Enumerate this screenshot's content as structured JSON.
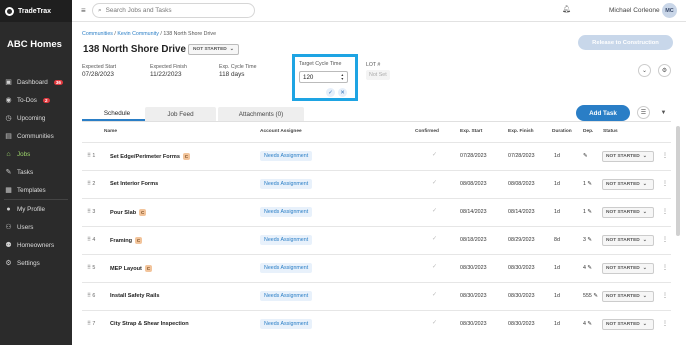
{
  "sidebar": {
    "brand": "TradeTrax",
    "company": "ABC Homes",
    "items": [
      {
        "label": "Dashboard",
        "icon": "dashboard-icon",
        "badge": "36"
      },
      {
        "label": "To-Dos",
        "icon": "todo-icon",
        "badge": "2"
      },
      {
        "label": "Upcoming",
        "icon": "calendar-icon",
        "badge": ""
      },
      {
        "label": "Communities",
        "icon": "communities-icon",
        "badge": ""
      },
      {
        "label": "Jobs",
        "icon": "home-icon",
        "badge": ""
      },
      {
        "label": "Tasks",
        "icon": "wrench-icon",
        "badge": ""
      },
      {
        "label": "Templates",
        "icon": "templates-icon",
        "badge": ""
      },
      {
        "label": "My Profile",
        "icon": "profile-icon",
        "badge": ""
      },
      {
        "label": "Users",
        "icon": "users-icon",
        "badge": ""
      },
      {
        "label": "Homeowners",
        "icon": "homeowners-icon",
        "badge": ""
      },
      {
        "label": "Settings",
        "icon": "gear-icon",
        "badge": ""
      }
    ],
    "active": "Jobs"
  },
  "topbar": {
    "search_placeholder": "Search Jobs and Tasks",
    "user_name": "Michael Corleone",
    "avatar_initials": "MC"
  },
  "job": {
    "breadcrumb": {
      "communities": "Communities",
      "community": "Kevin Community",
      "current": "138 North Shore Drive"
    },
    "title": "138 North Shore Drive",
    "status": "NOT STARTED",
    "release_button": "Release to Construction",
    "expected_start_label": "Expected Start",
    "expected_start": "07/28/2023",
    "expected_finish_label": "Expected Finish",
    "expected_finish": "11/22/2023",
    "cycle_time_label": "Exp. Cycle Time",
    "cycle_time": "118 days",
    "target_cycle_label": "Target Cycle Time",
    "target_cycle_value": "120",
    "lot_label": "LOT #",
    "lot_placeholder": "Not Set"
  },
  "tabs": [
    {
      "label": "Schedule"
    },
    {
      "label": "Job Feed"
    },
    {
      "label": "Attachments (0)"
    }
  ],
  "add_task_label": "Add Task",
  "table": {
    "headers": {
      "name": "Name",
      "assignee": "Account Assignee",
      "confirmed": "Confirmed",
      "start": "Exp. Start",
      "finish": "Exp. Finish",
      "duration": "Duration",
      "dep": "Dep.",
      "status": "Status"
    },
    "rows": [
      {
        "num": "1",
        "name": "Set Edge/Perimeter Forms",
        "badge": "C",
        "assignee": "Needs Assignment",
        "start": "07/28/2023",
        "finish": "07/28/2023",
        "duration": "1d",
        "dep": "",
        "status": "NOT STARTED"
      },
      {
        "num": "2",
        "name": "Set Interior Forms",
        "badge": "",
        "assignee": "Needs Assignment",
        "start": "08/08/2023",
        "finish": "08/08/2023",
        "duration": "1d",
        "dep": "1",
        "status": "NOT STARTED"
      },
      {
        "num": "3",
        "name": "Pour Slab",
        "badge": "C",
        "assignee": "Needs Assignment",
        "start": "08/14/2023",
        "finish": "08/14/2023",
        "duration": "1d",
        "dep": "1",
        "status": "NOT STARTED"
      },
      {
        "num": "4",
        "name": "Framing",
        "badge": "C",
        "assignee": "Needs Assignment",
        "start": "08/18/2023",
        "finish": "08/29/2023",
        "duration": "8d",
        "dep": "3",
        "status": "NOT STARTED"
      },
      {
        "num": "5",
        "name": "MEP Layout",
        "badge": "C",
        "assignee": "Needs Assignment",
        "start": "08/30/2023",
        "finish": "08/30/2023",
        "duration": "1d",
        "dep": "4",
        "status": "NOT STARTED"
      },
      {
        "num": "6",
        "name": "Install Safety Rails",
        "badge": "",
        "assignee": "Needs Assignment",
        "start": "08/30/2023",
        "finish": "08/30/2023",
        "duration": "1d",
        "dep": "555",
        "status": "NOT STARTED"
      },
      {
        "num": "7",
        "name": "City Strap & Shear Inspection",
        "badge": "",
        "assignee": "Needs Assignment",
        "start": "08/30/2023",
        "finish": "08/30/2023",
        "duration": "1d",
        "dep": "4",
        "status": "NOT STARTED"
      }
    ]
  }
}
